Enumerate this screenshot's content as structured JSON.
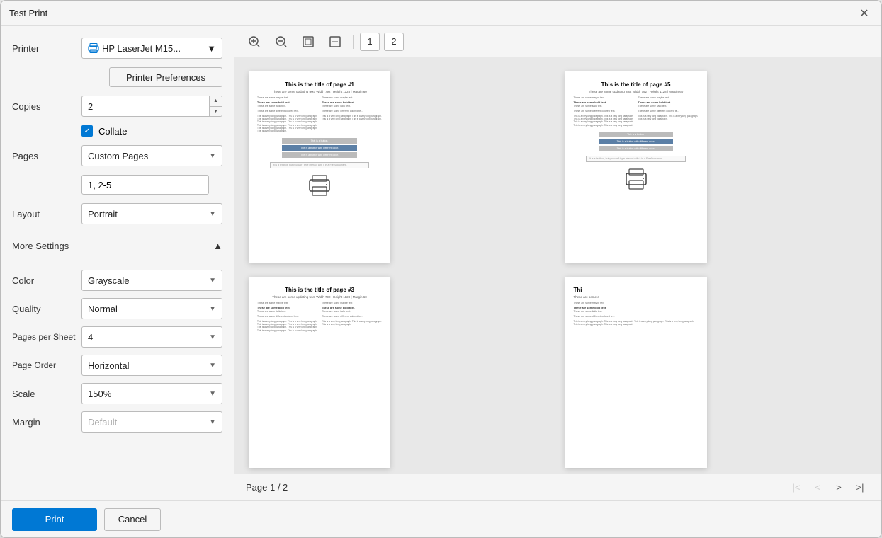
{
  "dialog": {
    "title": "Test Print",
    "close_label": "✕"
  },
  "left_panel": {
    "printer_label": "Printer",
    "printer_value": "HP LaserJet M15...",
    "printer_preferences_btn": "Printer Preferences",
    "copies_label": "Copies",
    "copies_value": "2",
    "collate_label": "Collate",
    "pages_label": "Pages",
    "pages_value": "Custom Pages",
    "pages_input_value": "1, 2-5",
    "layout_label": "Layout",
    "layout_value": "Portrait",
    "more_settings_label": "More Settings",
    "color_label": "Color",
    "color_value": "Grayscale",
    "quality_label": "Quality",
    "quality_value": "Normal",
    "pages_per_sheet_label": "Pages per Sheet",
    "pages_per_sheet_value": "4",
    "page_order_label": "Page Order",
    "page_order_value": "Horizontal",
    "scale_label": "Scale",
    "scale_value": "150%",
    "margin_label": "Margin",
    "margin_value": "Default"
  },
  "bottom_bar": {
    "print_label": "Print",
    "cancel_label": "Cancel"
  },
  "preview": {
    "zoom_in_icon": "⊕",
    "zoom_out_icon": "⊖",
    "fit_page_icon": "⊞",
    "fit_width_icon": "⊡",
    "page1_label": "1",
    "page2_label": "2",
    "pages": [
      {
        "title": "This is the title of page #1",
        "subtitle": "These are some updating text: Width 792 | Height 1128 | Margin 60",
        "partial_subtitle": "These are some c"
      },
      {
        "title": "This is the title of page #5",
        "subtitle": "These are some updating text: Width 792 | Height 1128 | Margin 60",
        "partial_subtitle": "These are some c"
      },
      {
        "title": "This is the title of page #3",
        "subtitle": "These are some updating text: Width 792 | Height 1128 | Margin 60",
        "partial_subtitle": "These are some c"
      },
      {
        "title": "Thi",
        "subtitle": "These are some c",
        "partial": true
      }
    ],
    "page_info": "Page 1 / 2",
    "nav": {
      "first": "|<",
      "prev": "<",
      "next": ">",
      "last": ">|"
    }
  }
}
